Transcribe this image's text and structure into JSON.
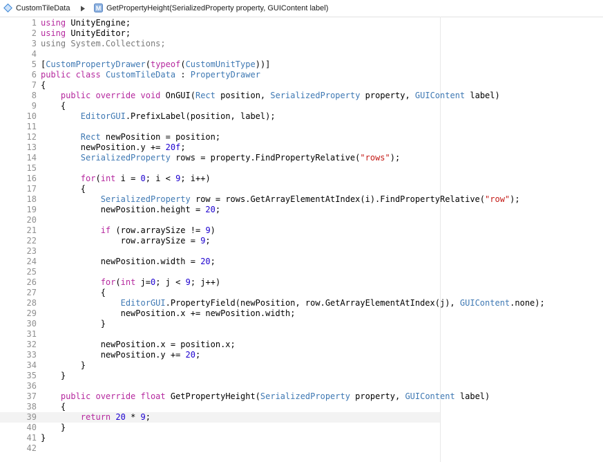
{
  "colors": {
    "keyword": "#b5289e",
    "type": "#3e78b3",
    "string": "#c41a16",
    "number": "#1c00cf",
    "plain": "#000000",
    "dim": "#7a7a7a",
    "line_number": "#8f8f8f"
  },
  "breadcrumb": {
    "items": [
      {
        "label": "CustomTileData",
        "icon": "csharp-file-icon"
      },
      {
        "label": "GetPropertyHeight(SerializedProperty property, GUIContent label)",
        "icon": "method-icon",
        "icon_letter": "M"
      }
    ],
    "separator_icon": "chevron-right-icon"
  },
  "editor": {
    "lines": [
      {
        "n": "1",
        "t": [
          [
            "k",
            "using"
          ],
          [
            "p",
            " UnityEngine;"
          ]
        ]
      },
      {
        "n": "2",
        "t": [
          [
            "k",
            "using"
          ],
          [
            "p",
            " UnityEditor;"
          ]
        ]
      },
      {
        "n": "3",
        "t": [
          [
            "dk",
            "using"
          ],
          [
            "d",
            " System.Collections;"
          ]
        ]
      },
      {
        "n": "4",
        "t": []
      },
      {
        "n": "5",
        "t": [
          [
            "p",
            "["
          ],
          [
            "y",
            "CustomPropertyDrawer"
          ],
          [
            "p",
            "("
          ],
          [
            "k",
            "typeof"
          ],
          [
            "p",
            "("
          ],
          [
            "y",
            "CustomUnitType"
          ],
          [
            "p",
            "))]"
          ]
        ]
      },
      {
        "n": "6",
        "t": [
          [
            "k",
            "public class"
          ],
          [
            "p",
            " "
          ],
          [
            "y",
            "CustomTileData"
          ],
          [
            "p",
            " : "
          ],
          [
            "y",
            "PropertyDrawer"
          ]
        ]
      },
      {
        "n": "7",
        "t": [
          [
            "p",
            "{"
          ]
        ]
      },
      {
        "n": "8",
        "t": [
          [
            "p",
            "    "
          ],
          [
            "k",
            "public override void"
          ],
          [
            "p",
            " OnGUI("
          ],
          [
            "y",
            "Rect"
          ],
          [
            "p",
            " position, "
          ],
          [
            "y",
            "SerializedProperty"
          ],
          [
            "p",
            " property, "
          ],
          [
            "y",
            "GUIContent"
          ],
          [
            "p",
            " label)"
          ]
        ]
      },
      {
        "n": "9",
        "t": [
          [
            "p",
            "    {"
          ]
        ]
      },
      {
        "n": "10",
        "t": [
          [
            "p",
            "        "
          ],
          [
            "y",
            "EditorGUI"
          ],
          [
            "p",
            ".PrefixLabel(position, label);"
          ]
        ]
      },
      {
        "n": "11",
        "t": []
      },
      {
        "n": "12",
        "t": [
          [
            "p",
            "        "
          ],
          [
            "y",
            "Rect"
          ],
          [
            "p",
            " newPosition = position;"
          ]
        ]
      },
      {
        "n": "13",
        "t": [
          [
            "p",
            "        newPosition.y += "
          ],
          [
            "n",
            "20f"
          ],
          [
            "p",
            ";"
          ]
        ]
      },
      {
        "n": "14",
        "t": [
          [
            "p",
            "        "
          ],
          [
            "y",
            "SerializedProperty"
          ],
          [
            "p",
            " rows = property.FindPropertyRelative("
          ],
          [
            "s",
            "\"rows\""
          ],
          [
            "p",
            ");"
          ]
        ]
      },
      {
        "n": "15",
        "t": []
      },
      {
        "n": "16",
        "t": [
          [
            "p",
            "        "
          ],
          [
            "k",
            "for"
          ],
          [
            "p",
            "("
          ],
          [
            "k",
            "int"
          ],
          [
            "p",
            " i = "
          ],
          [
            "n",
            "0"
          ],
          [
            "p",
            "; i < "
          ],
          [
            "n",
            "9"
          ],
          [
            "p",
            "; i++)"
          ]
        ]
      },
      {
        "n": "17",
        "t": [
          [
            "p",
            "        {"
          ]
        ]
      },
      {
        "n": "18",
        "t": [
          [
            "p",
            "            "
          ],
          [
            "y",
            "SerializedProperty"
          ],
          [
            "p",
            " row = rows.GetArrayElementAtIndex(i).FindPropertyRelative("
          ],
          [
            "s",
            "\"row\""
          ],
          [
            "p",
            ");"
          ]
        ]
      },
      {
        "n": "19",
        "t": [
          [
            "p",
            "            newPosition.height = "
          ],
          [
            "n",
            "20"
          ],
          [
            "p",
            ";"
          ]
        ]
      },
      {
        "n": "20",
        "t": []
      },
      {
        "n": "21",
        "t": [
          [
            "p",
            "            "
          ],
          [
            "k",
            "if"
          ],
          [
            "p",
            " (row.arraySize != "
          ],
          [
            "n",
            "9"
          ],
          [
            "p",
            ")"
          ]
        ]
      },
      {
        "n": "22",
        "t": [
          [
            "p",
            "                row.arraySize = "
          ],
          [
            "n",
            "9"
          ],
          [
            "p",
            ";"
          ]
        ]
      },
      {
        "n": "23",
        "t": []
      },
      {
        "n": "24",
        "t": [
          [
            "p",
            "            newPosition.width = "
          ],
          [
            "n",
            "20"
          ],
          [
            "p",
            ";"
          ]
        ]
      },
      {
        "n": "25",
        "t": []
      },
      {
        "n": "26",
        "t": [
          [
            "p",
            "            "
          ],
          [
            "k",
            "for"
          ],
          [
            "p",
            "("
          ],
          [
            "k",
            "int"
          ],
          [
            "p",
            " j="
          ],
          [
            "n",
            "0"
          ],
          [
            "p",
            "; j < "
          ],
          [
            "n",
            "9"
          ],
          [
            "p",
            "; j++)"
          ]
        ]
      },
      {
        "n": "27",
        "t": [
          [
            "p",
            "            {"
          ]
        ]
      },
      {
        "n": "28",
        "t": [
          [
            "p",
            "                "
          ],
          [
            "y",
            "EditorGUI"
          ],
          [
            "p",
            ".PropertyField(newPosition, row.GetArrayElementAtIndex(j), "
          ],
          [
            "y",
            "GUIContent"
          ],
          [
            "p",
            ".none);"
          ]
        ]
      },
      {
        "n": "29",
        "t": [
          [
            "p",
            "                newPosition.x += newPosition.width;"
          ]
        ]
      },
      {
        "n": "30",
        "t": [
          [
            "p",
            "            }"
          ]
        ]
      },
      {
        "n": "31",
        "t": []
      },
      {
        "n": "32",
        "t": [
          [
            "p",
            "            newPosition.x = position.x;"
          ]
        ]
      },
      {
        "n": "33",
        "t": [
          [
            "p",
            "            newPosition.y += "
          ],
          [
            "n",
            "20"
          ],
          [
            "p",
            ";"
          ]
        ]
      },
      {
        "n": "34",
        "t": [
          [
            "p",
            "        }"
          ]
        ]
      },
      {
        "n": "35",
        "t": [
          [
            "p",
            "    }"
          ]
        ]
      },
      {
        "n": "36",
        "t": []
      },
      {
        "n": "37",
        "t": [
          [
            "p",
            "    "
          ],
          [
            "k",
            "public override float"
          ],
          [
            "p",
            " GetPropertyHeight("
          ],
          [
            "y",
            "SerializedProperty"
          ],
          [
            "p",
            " property, "
          ],
          [
            "y",
            "GUIContent"
          ],
          [
            "p",
            " label)"
          ]
        ]
      },
      {
        "n": "38",
        "t": [
          [
            "p",
            "    {"
          ]
        ]
      },
      {
        "n": "39",
        "t": [
          [
            "p",
            "        "
          ],
          [
            "k",
            "return"
          ],
          [
            "p",
            " "
          ],
          [
            "n",
            "20"
          ],
          [
            "p",
            " * "
          ],
          [
            "n",
            "9"
          ],
          [
            "p",
            ";"
          ]
        ],
        "highlight": true
      },
      {
        "n": "40",
        "t": [
          [
            "p",
            "    }"
          ]
        ]
      },
      {
        "n": "41",
        "t": [
          [
            "p",
            "}"
          ]
        ]
      },
      {
        "n": "42",
        "t": []
      }
    ]
  }
}
